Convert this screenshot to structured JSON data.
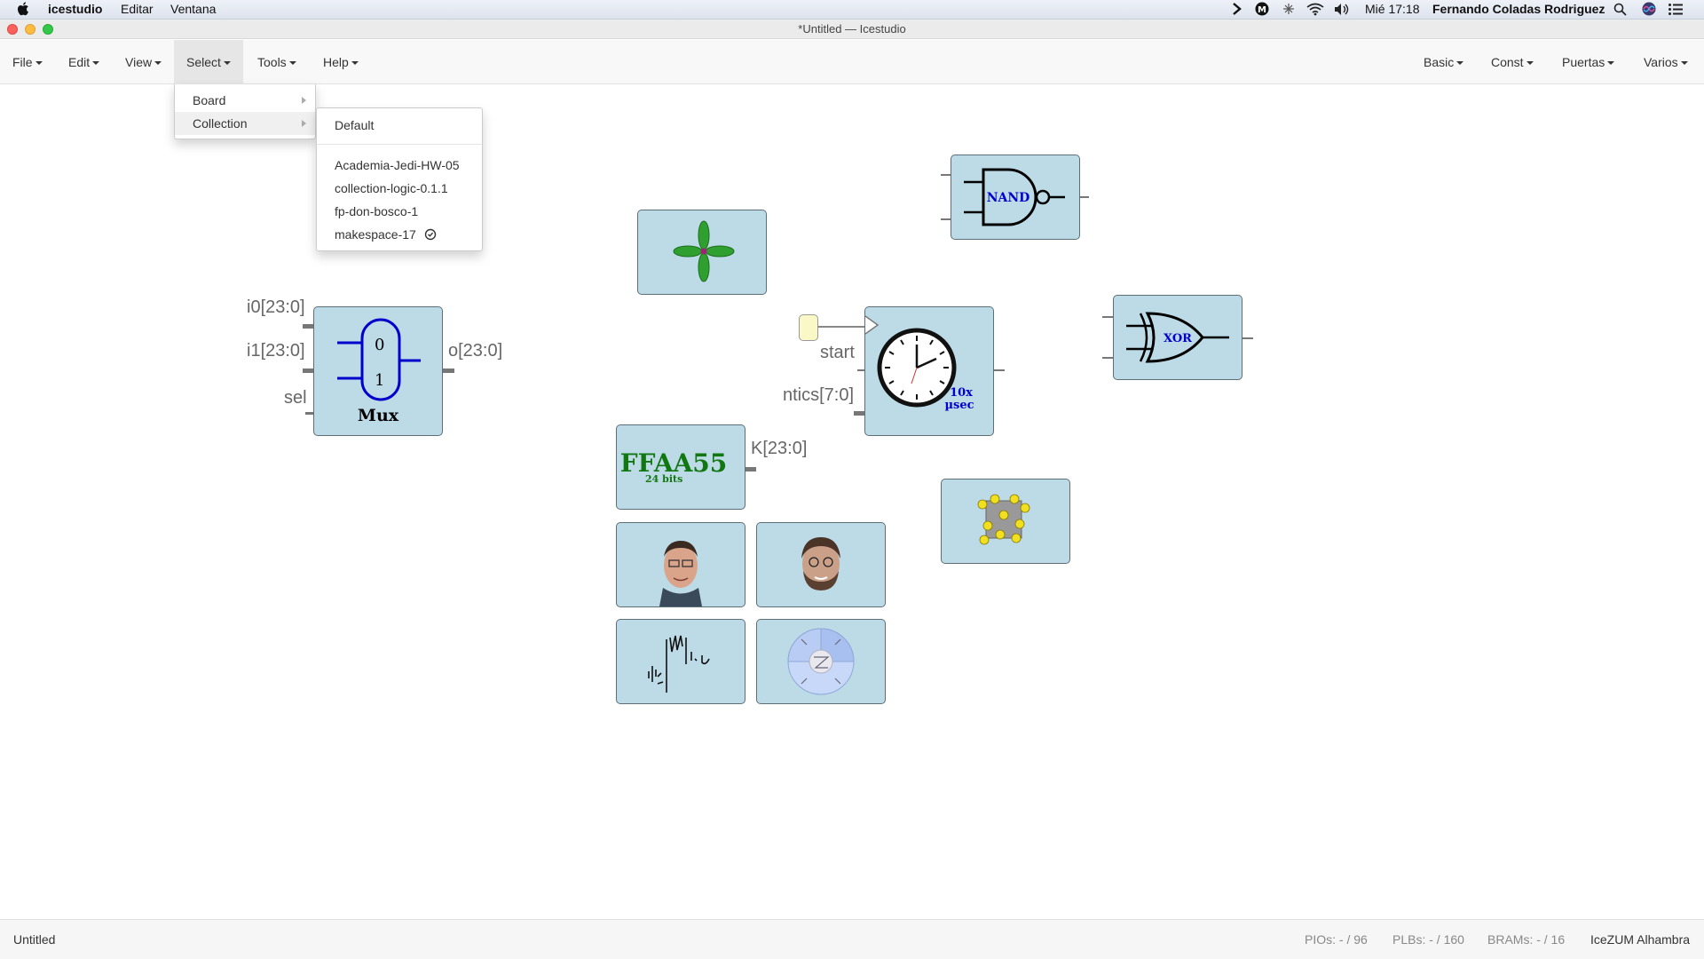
{
  "macbar": {
    "app_name": "icestudio",
    "menus": [
      "Editar",
      "Ventana"
    ],
    "clock": "Mié 17:18",
    "user": "Fernando Coladas Rodriguez"
  },
  "window": {
    "title": "*Untitled — Icestudio"
  },
  "nav": {
    "left": [
      "File",
      "Edit",
      "View",
      "Select",
      "Tools",
      "Help"
    ],
    "right": [
      "Basic",
      "Const",
      "Puertas",
      "Varios"
    ],
    "active": "Select"
  },
  "select_menu": {
    "items": [
      "Board",
      "Collection"
    ],
    "highlighted": "Collection"
  },
  "collection_menu": {
    "default": "Default",
    "items": [
      "Academia-Jedi-HW-05",
      "collection-logic-0.1.1",
      "fp-don-bosco-1",
      "makespace-17"
    ],
    "selected": "makespace-17"
  },
  "canvas": {
    "mux": {
      "title": "Mux",
      "in0": "0",
      "in1": "1",
      "port_i0": "i0[23:0]",
      "port_i1": "i1[23:0]",
      "port_sel": "sel",
      "port_out": "o[23:0]"
    },
    "const": {
      "value": "FFAA55",
      "bits": "24 bits",
      "port": "K[23:0]"
    },
    "timer": {
      "port_start": "start",
      "port_ntics": "ntics[7:0]",
      "unit_line1": "10x",
      "unit_line2": "µsec"
    },
    "nand": {
      "label": "NAND"
    },
    "xor": {
      "label": "XOR"
    }
  },
  "status": {
    "file": "Untitled",
    "pios": "PIOs: - / 96",
    "plbs": "PLBs: - / 160",
    "brams": "BRAMs: - / 16",
    "board": "IceZUM Alhambra"
  },
  "colors": {
    "block_fill": "#bddbe7",
    "mux_blue": "#0000cc",
    "const_green": "#117711"
  }
}
